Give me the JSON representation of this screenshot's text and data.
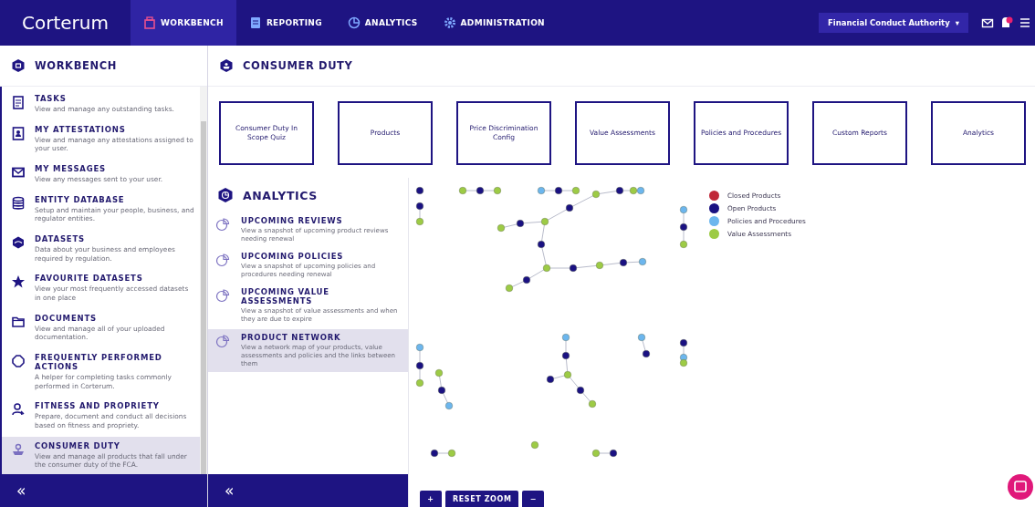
{
  "app": {
    "brand": "Corterum"
  },
  "nav_tabs": [
    {
      "label": "WORKBENCH",
      "selected": true
    },
    {
      "label": "REPORTING",
      "selected": false
    },
    {
      "label": "ANALYTICS",
      "selected": false
    },
    {
      "label": "ADMINISTRATION",
      "selected": false
    }
  ],
  "organization_selector": {
    "value": "Financial Conduct Authority",
    "caret": "▾"
  },
  "sidebar": {
    "title": "WORKBENCH",
    "collapse": "«",
    "items": [
      {
        "title": "TASKS",
        "description": "View and manage any outstanding tasks.",
        "selected": false
      },
      {
        "title": "MY ATTESTATIONS",
        "description": "View and manage any attestations assigned to your user.",
        "selected": false
      },
      {
        "title": "MY MESSAGES",
        "description": "View any messages sent to your user.",
        "selected": false
      },
      {
        "title": "ENTITY DATABASE",
        "description": "Setup and maintain your people, business, and regulator entities.",
        "selected": false
      },
      {
        "title": "DATASETS",
        "description": "Data about your business and employees required by regulation.",
        "selected": false
      },
      {
        "title": "FAVOURITE DATASETS",
        "description": "View your most frequently accessed datasets in one place",
        "selected": false
      },
      {
        "title": "DOCUMENTS",
        "description": "View and manage all of your uploaded documentation.",
        "selected": false
      },
      {
        "title": "FREQUENTLY PERFORMED ACTIONS",
        "description": "A helper for completing tasks commonly performed in Corterum.",
        "selected": false
      },
      {
        "title": "FITNESS AND PROPRIETY",
        "description": "Prepare, document and conduct all decisions based on fitness and propriety.",
        "selected": false
      },
      {
        "title": "CONSUMER DUTY",
        "description": "View and manage all products that fall under the consumer duty of the FCA.",
        "selected": true
      }
    ]
  },
  "page": {
    "title": "CONSUMER DUTY"
  },
  "tiles": [
    "Consumer Duty In Scope Quiz",
    "Products",
    "Price Discrimination Config",
    "Value Assessments",
    "Policies and Procedures",
    "Custom Reports",
    "Analytics"
  ],
  "analytics": {
    "title": "ANALYTICS",
    "collapse": "«",
    "items": [
      {
        "title": "UPCOMING REVIEWS",
        "description": "View a snapshot of upcoming product reviews needing renewal",
        "selected": false
      },
      {
        "title": "UPCOMING POLICIES",
        "description": "View a snapshot of upcoming policies and procedures needing renewal",
        "selected": false
      },
      {
        "title": "UPCOMING VALUE ASSESSMENTS",
        "description": "View a snapshot of value assessments and when they are due to expire",
        "selected": false
      },
      {
        "title": "PRODUCT NETWORK",
        "description": "View a network map of your products, value assessments and policies and the links between them",
        "selected": true
      }
    ]
  },
  "legend": [
    {
      "label": "Closed Products",
      "color": "#c02838"
    },
    {
      "label": "Open Products",
      "color": "#1a1182"
    },
    {
      "label": "Policies and Procedures",
      "color": "#6cb6ee"
    },
    {
      "label": "Value Assessments",
      "color": "#9dcb45"
    }
  ],
  "zoom_controls": {
    "zoom_in": "+",
    "reset": "RESET ZOOM",
    "zoom_out": "−"
  }
}
